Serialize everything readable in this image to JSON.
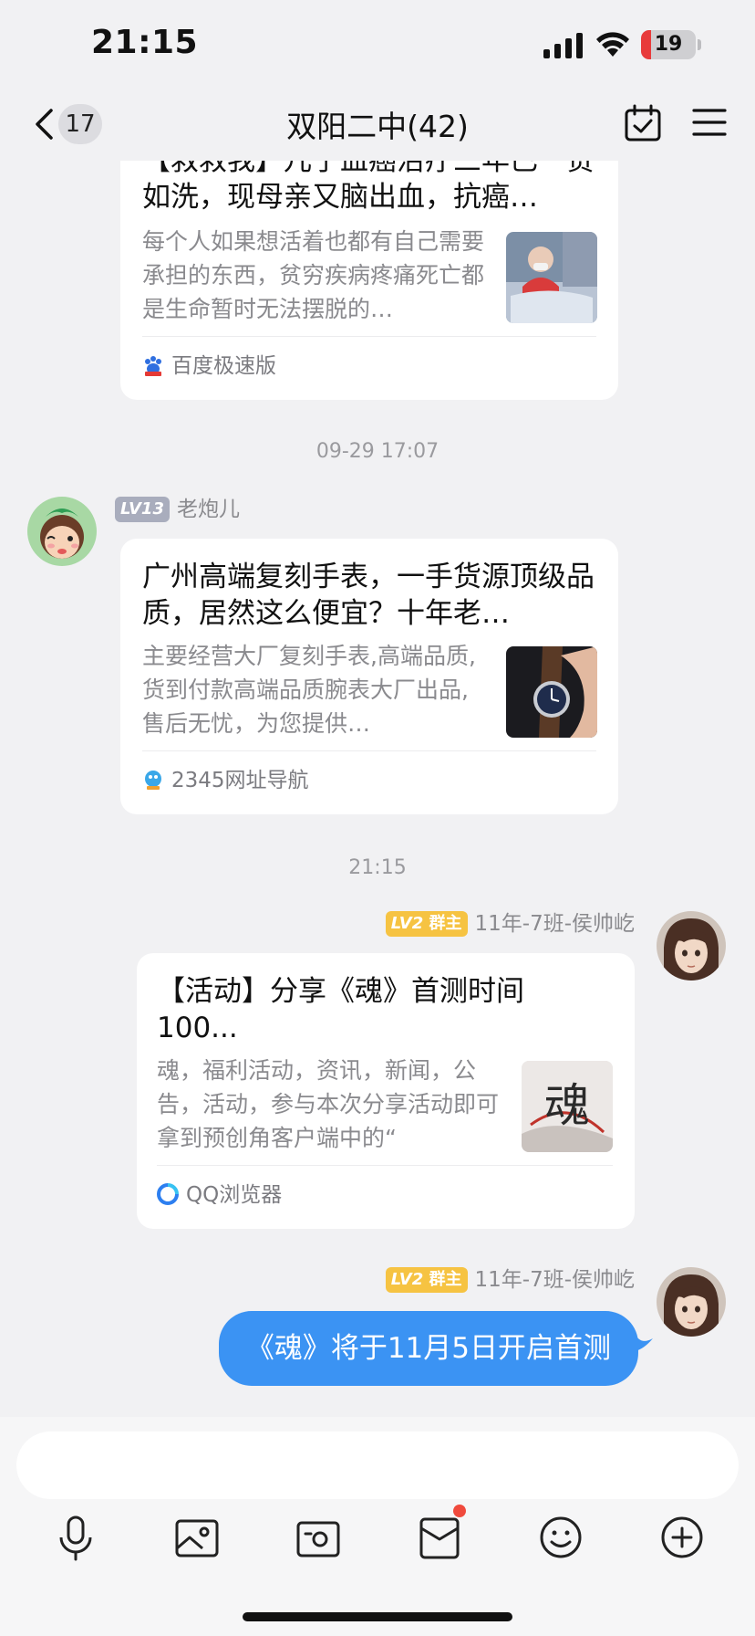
{
  "status_bar": {
    "time": "21:15",
    "battery": "19",
    "battery_level": 0.19
  },
  "nav": {
    "back_count": "17",
    "title": "双阳二中(42)"
  },
  "messages": {
    "card1": {
      "title": "【救救我】儿子血癌治疗三年已一贫如洗，现母亲又脑出血，抗癌…",
      "desc": "每个人如果想活着也都有自己需要承担的东西，贫穷疾病疼痛死亡都是生命暂时无法摆脱的…",
      "source": "百度极速版"
    },
    "time1": "09-29 17:07",
    "msg2": {
      "level": "LV13",
      "sender": "老炮儿",
      "title": "广州高端复刻手表，一手货源顶级品质，居然这么便宜？十年老…",
      "desc": "主要经营大厂复刻手表,高端品质,货到付款高端品质腕表大厂出品,售后无忧，为您提供…",
      "source": "2345网址导航"
    },
    "time2": "21:15",
    "msg3": {
      "level": "LV2",
      "role": "群主",
      "sender": "11年-7班-侯帅屹",
      "title": "【活动】分享《魂》首测时间100...",
      "desc": "魂，福利活动，资讯，新闻，公告，活动，参与本次分享活动即可拿到预创角客户端中的“",
      "source": "QQ浏览器",
      "thumb_glyph": "魂"
    },
    "msg4": {
      "level": "LV2",
      "role": "群主",
      "sender": "11年-7班-侯帅屹",
      "text": "《魂》将于11月5日开启首测"
    }
  },
  "input": {
    "placeholder": ""
  },
  "colors": {
    "bubble": "#3b93f3",
    "badge_gold": "#f6c342",
    "badge_grey": "#a9adbd",
    "battery_red": "#e83b3b",
    "notify_dot": "#f04a3d"
  },
  "icons": [
    "back-chevron-icon",
    "calendar-check-icon",
    "menu-icon",
    "microphone-icon",
    "image-icon",
    "camera-icon",
    "red-packet-icon",
    "emoji-icon",
    "plus-icon"
  ]
}
